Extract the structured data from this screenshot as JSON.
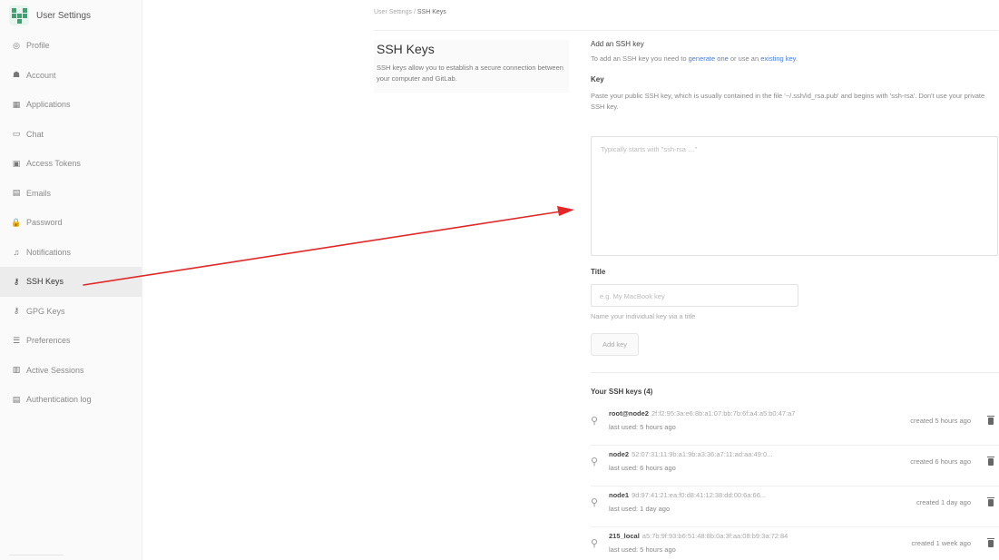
{
  "sidebar": {
    "title": "User Settings",
    "items": [
      {
        "label": "Profile",
        "icon": "profile-icon",
        "glyph": "◎"
      },
      {
        "label": "Account",
        "icon": "account-icon",
        "glyph": "☗"
      },
      {
        "label": "Applications",
        "icon": "applications-icon",
        "glyph": "▦"
      },
      {
        "label": "Chat",
        "icon": "chat-icon",
        "glyph": "▭"
      },
      {
        "label": "Access Tokens",
        "icon": "access-tokens-icon",
        "glyph": "▣"
      },
      {
        "label": "Emails",
        "icon": "emails-icon",
        "glyph": "▤"
      },
      {
        "label": "Password",
        "icon": "password-icon",
        "glyph": "🔒"
      },
      {
        "label": "Notifications",
        "icon": "notifications-icon",
        "glyph": "♫"
      },
      {
        "label": "SSH Keys",
        "icon": "ssh-key-icon",
        "glyph": "⚷",
        "active": true
      },
      {
        "label": "GPG Keys",
        "icon": "gpg-key-icon",
        "glyph": "⚷"
      },
      {
        "label": "Preferences",
        "icon": "preferences-icon",
        "glyph": "☰"
      },
      {
        "label": "Active Sessions",
        "icon": "active-sessions-icon",
        "glyph": "▥"
      },
      {
        "label": "Authentication log",
        "icon": "authentication-log-icon",
        "glyph": "▤"
      }
    ]
  },
  "breadcrumb": {
    "parent": "User Settings",
    "separator": "/",
    "current": "SSH Keys"
  },
  "section": {
    "title": "SSH Keys",
    "description": "SSH keys allow you to establish a secure connection between your computer and GitLab."
  },
  "add": {
    "heading": "Add an SSH key",
    "intro_prefix": "To add an SSH key you need to ",
    "intro_link1": "generate one",
    "intro_mid": " or use an ",
    "intro_link2": "existing key",
    "intro_suffix": ".",
    "key_label": "Key",
    "key_help": "Paste your public SSH key, which is usually contained in the file '~/.ssh/id_rsa.pub' and begins with 'ssh-rsa'. Don't use your private SSH key.",
    "key_placeholder": "Typically starts with \"ssh-rsa …\"",
    "title_label": "Title",
    "title_placeholder": "e.g. My MacBook key",
    "title_help": "Name your individual key via a title",
    "button": "Add key"
  },
  "keys": {
    "heading": "Your SSH keys (4)",
    "items": [
      {
        "name": "root@node2",
        "fingerprint": "2f:f2:95:3a:e6:8b:a1:07:bb:7b:6f:a4:a5:b0:47:a7",
        "last_used": "last used: 5 hours ago",
        "created": "created 5 hours ago"
      },
      {
        "name": "node2",
        "fingerprint": "52:07:31:11:9b:a1:9b:a3:36:a7:11:ad:aa:49:0...",
        "last_used": "last used: 6 hours ago",
        "created": "created 6 hours ago"
      },
      {
        "name": "node1",
        "fingerprint": "9d:97:41:21:ea:f0:d8:41:12:38:dd:00:6a:66...",
        "last_used": "last used: 1 day ago",
        "created": "created 1 day ago"
      },
      {
        "name": "215_local",
        "fingerprint": "a5:7b:9f:93:b6:51:48:8b:0a:3f:aa:08:b9:3a:72:84",
        "last_used": "last used: 5 hours ago",
        "created": "created 1 week ago"
      }
    ]
  },
  "colors": {
    "annotation_arrow": "#e32727",
    "link": "#4a7ed6",
    "avatar": "#3ba272"
  }
}
